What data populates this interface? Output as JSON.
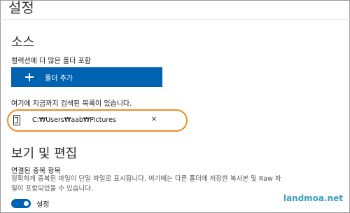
{
  "header": {
    "title": "설정"
  },
  "source": {
    "heading": "소스",
    "include_label": "컬렉션에 더 많은 폴더 포함",
    "add_folder_label": "폴더 추가",
    "searched_list_label": "여기에 지금까지 검색된 목록이 있습니다.",
    "folder_path": "C:₩Users₩aab₩Pictures",
    "remove_glyph": "×"
  },
  "view_edit": {
    "heading": "보기 및 편집",
    "linked_duplicates_label": "연결된 중복 항목",
    "description": "정확하게 중복된 파일이 단일 파일로 표시됩니다. 여기에는 다른 폴더에 저장한 복사본 및 Raw 파일이 포함되었을 수 있습니다.",
    "toggle_state": "설정",
    "toggle_on": true
  },
  "watermark": "landmoa.net",
  "colors": {
    "accent": "#0063b1",
    "highlight": "#f08a24",
    "watermark": "#3a9fbf"
  },
  "icons": {
    "add": "plus-icon",
    "folder": "folder-icon",
    "remove": "close-icon"
  }
}
